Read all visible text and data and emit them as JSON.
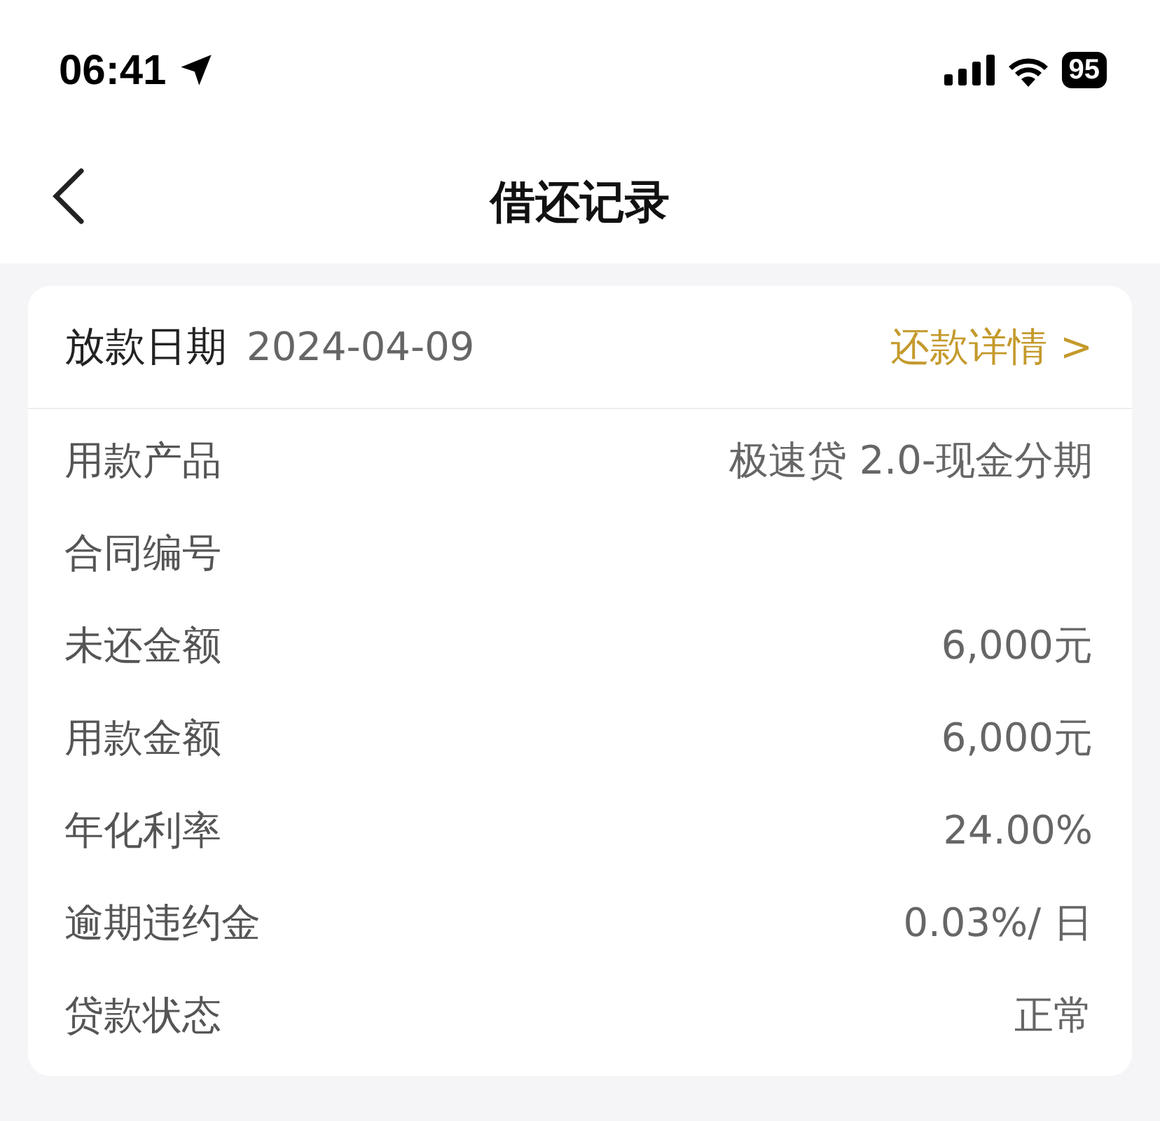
{
  "status_bar": {
    "time": "06:41",
    "battery": "95"
  },
  "nav": {
    "title": "借还记录"
  },
  "record": {
    "header": {
      "label": "放款日期",
      "date": "2024-04-09",
      "link": "还款详情 >"
    },
    "rows": [
      {
        "label": "用款产品",
        "value": "极速贷 2.0-现金分期"
      },
      {
        "label": "合同编号"
      },
      {
        "label": "未还金额",
        "value": "6,000元"
      },
      {
        "label": "用款金额",
        "value": "6,000元"
      },
      {
        "label": "年化利率",
        "value": "24.00%"
      },
      {
        "label": "逾期违约金",
        "value": "0.03%/ 日"
      },
      {
        "label": "贷款状态",
        "value": "正常"
      }
    ]
  }
}
